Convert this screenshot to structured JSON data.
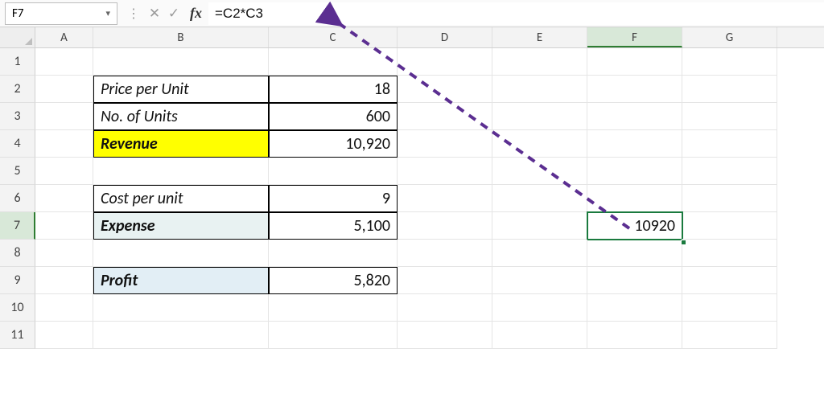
{
  "formula_bar": {
    "name_box": "F7",
    "formula": "=C2*C3"
  },
  "columns": [
    "A",
    "B",
    "C",
    "D",
    "E",
    "F",
    "G"
  ],
  "rows": [
    "1",
    "2",
    "3",
    "4",
    "5",
    "6",
    "7",
    "8",
    "9",
    "10",
    "11"
  ],
  "cells": {
    "B2": "Price per Unit",
    "C2": "18",
    "B3": "No. of Units",
    "C3": "600",
    "B4": "Revenue",
    "C4": "10,920",
    "B6": "Cost per unit",
    "C6": "9",
    "B7": "Expense",
    "C7": "5,100",
    "B9": "Profit",
    "C9": "5,820",
    "F7": "10920"
  },
  "active_cell": "F7",
  "colors": {
    "highlight_yellow": "#ffff00",
    "selection_border": "#1a7a3e",
    "arrow": "#5b2e91"
  }
}
